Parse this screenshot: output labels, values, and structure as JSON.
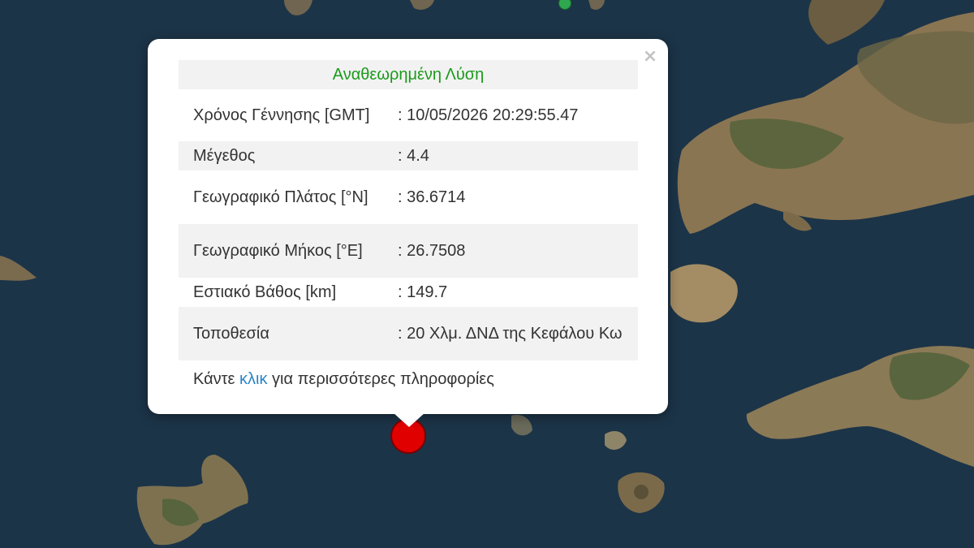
{
  "map": {
    "colors": {
      "sea": "#1c3448",
      "land_brown": "#8a7552",
      "land_green": "#50613a",
      "land_light": "#b9a27a"
    },
    "markers": [
      {
        "name": "earthquake-marker",
        "color": "#e00000"
      },
      {
        "name": "station-marker",
        "color": "#2fa84f"
      }
    ]
  },
  "popup": {
    "title": "Αναθεωρημένη Λύση",
    "close_icon": "×",
    "rows": [
      {
        "label": "Χρόνος Γέννησης [GMT]",
        "value": ": 10/05/2026 20:29:55.47"
      },
      {
        "label": "Μέγεθος",
        "value": ": 4.4"
      },
      {
        "label": "Γεωγραφικό Πλάτος [°N]",
        "value": ": 36.6714"
      },
      {
        "label": "Γεωγραφικό Μήκος [°E]",
        "value": ": 26.7508"
      },
      {
        "label": "Εστιακό Βάθος [km]",
        "value": ": 149.7"
      },
      {
        "label": "Τοποθεσία",
        "value": ": 20 Χλμ. ΔΝΔ της Κεφάλου Κω"
      }
    ],
    "footer": {
      "prefix": "Κάντε ",
      "link": "κλικ",
      "suffix": " για περισσότερες πληροφορίες"
    }
  }
}
